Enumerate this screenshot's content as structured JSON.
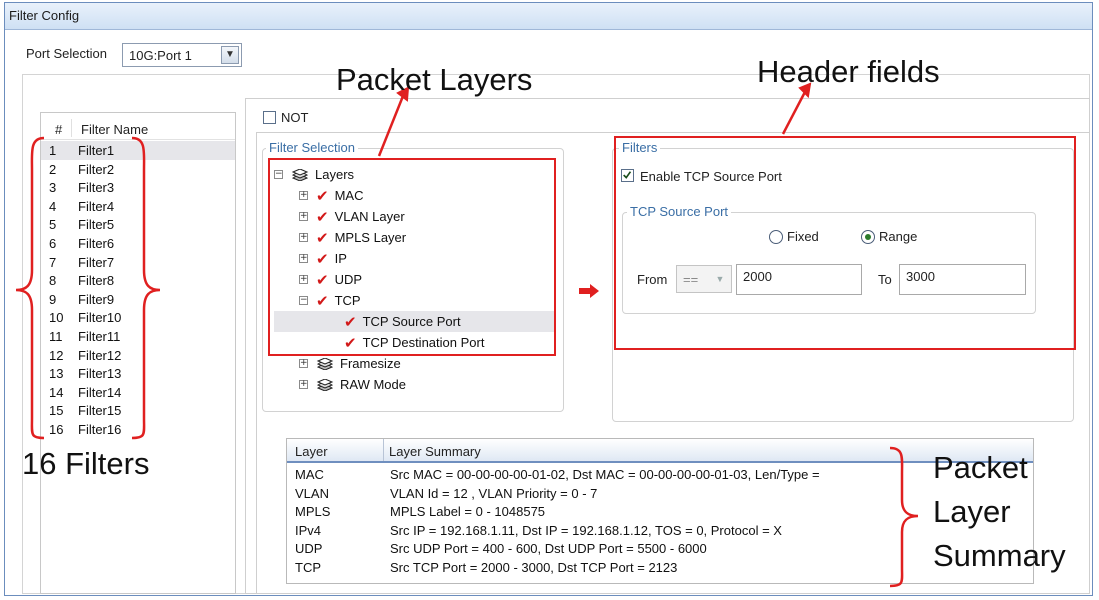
{
  "window": {
    "title": "Filter Config"
  },
  "port_selection": {
    "label": "Port Selection",
    "value": "10G:Port 1"
  },
  "filter_list": {
    "col_num": "#",
    "col_name": "Filter Name",
    "items": [
      {
        "num": "1",
        "name": "Filter1"
      },
      {
        "num": "2",
        "name": "Filter2"
      },
      {
        "num": "3",
        "name": "Filter3"
      },
      {
        "num": "4",
        "name": "Filter4"
      },
      {
        "num": "5",
        "name": "Filter5"
      },
      {
        "num": "6",
        "name": "Filter6"
      },
      {
        "num": "7",
        "name": "Filter7"
      },
      {
        "num": "8",
        "name": "Filter8"
      },
      {
        "num": "9",
        "name": "Filter9"
      },
      {
        "num": "10",
        "name": "Filter10"
      },
      {
        "num": "11",
        "name": "Filter11"
      },
      {
        "num": "12",
        "name": "Filter12"
      },
      {
        "num": "13",
        "name": "Filter13"
      },
      {
        "num": "14",
        "name": "Filter14"
      },
      {
        "num": "15",
        "name": "Filter15"
      },
      {
        "num": "16",
        "name": "Filter16"
      }
    ]
  },
  "not_checkbox": {
    "label": "NOT",
    "checked": false
  },
  "filter_selection": {
    "legend": "Filter Selection",
    "tree": {
      "root": "Layers",
      "nodes": [
        "MAC",
        "VLAN Layer",
        "MPLS Layer",
        "IP",
        "UDP",
        "TCP"
      ],
      "tcp_children": [
        "TCP Source Port",
        "TCP Destination Port"
      ],
      "extra": [
        "Framesize",
        "RAW Mode"
      ]
    }
  },
  "filters": {
    "legend": "Filters",
    "enable_label": "Enable TCP Source Port",
    "enabled": true,
    "group_legend": "TCP Source Port",
    "fixed_label": "Fixed",
    "range_label": "Range",
    "selected": "Range",
    "from_label": "From",
    "operator": "==",
    "from_value": "2000",
    "to_label": "To",
    "to_value": "3000"
  },
  "summary": {
    "col_layer": "Layer",
    "col_summary": "Layer Summary",
    "rows": [
      {
        "layer": "MAC",
        "summary": "Src MAC = 00-00-00-00-01-02, Dst MAC = 00-00-00-00-01-03, Len/Type  ="
      },
      {
        "layer": "VLAN",
        "summary": "VLAN Id = 12  ,  VLAN Priority = 0 - 7"
      },
      {
        "layer": "MPLS",
        "summary": "MPLS Label = 0 - 1048575"
      },
      {
        "layer": "IPv4",
        "summary": "Src IP = 192.168.1.11, Dst IP = 192.168.1.12, TOS = 0, Protocol = X"
      },
      {
        "layer": "UDP",
        "summary": "Src UDP Port = 400 - 600, Dst UDP Port = 5500 - 6000"
      },
      {
        "layer": "TCP",
        "summary": "Src TCP Port = 2000 - 3000, Dst TCP Port = 2123"
      }
    ]
  },
  "annotations": {
    "packet_layers": "Packet Layers",
    "header_fields": "Header fields",
    "sixteen_filters": "16 Filters",
    "summary_line1": "Packet",
    "summary_line2": "Layer",
    "summary_line3": "Summary"
  },
  "colors": {
    "annotation_red": "#e02020",
    "legend_blue": "#3a6ea5",
    "selection_bg": "#e6e6ea"
  },
  "icons": [
    "tree-expand-icon",
    "tree-collapse-icon",
    "layers-stack-icon",
    "red-checkmark-icon",
    "red-arrow-icon",
    "dropdown-chevron-icon"
  ]
}
